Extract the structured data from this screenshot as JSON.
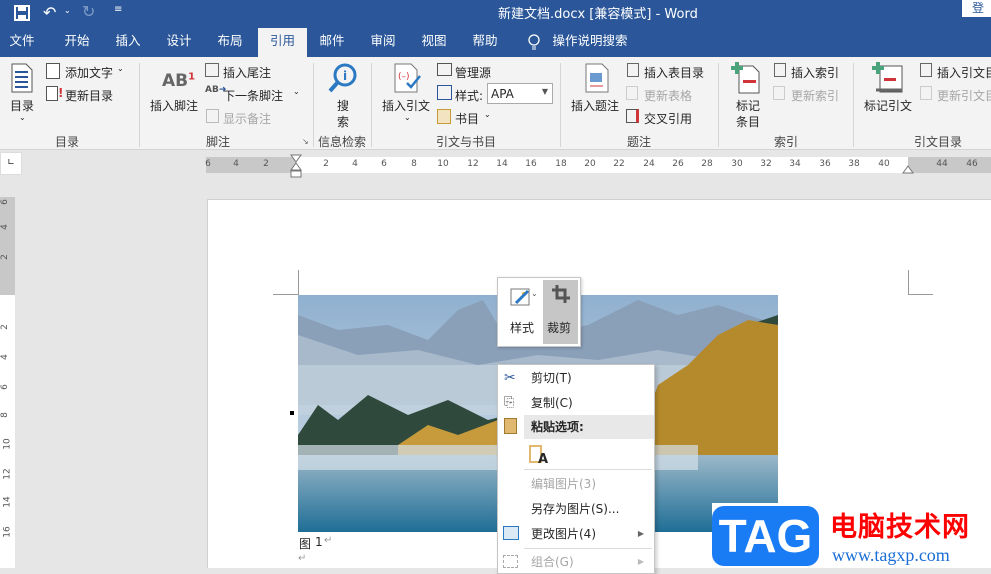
{
  "titlebar": {
    "title": "新建文档.docx [兼容模式]  -  Word",
    "login": "登录"
  },
  "tabs": [
    "文件",
    "开始",
    "插入",
    "设计",
    "布局",
    "引用",
    "邮件",
    "审阅",
    "视图",
    "帮助"
  ],
  "active_tab": "引用",
  "tell_me": "操作说明搜索",
  "ribbon": {
    "toc": {
      "toc": "目录",
      "add_text": "添加文字",
      "update_toc": "更新目录",
      "label": "目录"
    },
    "footnotes": {
      "insert_footnote": "插入脚注",
      "insert_endnote": "插入尾注",
      "next_footnote": "下一条脚注",
      "show_notes": "显示备注",
      "label": "脚注"
    },
    "research": {
      "search_1": "搜",
      "search_2": "索",
      "label": "信息检索"
    },
    "citations": {
      "insert_citation": "插入引文",
      "manage_sources": "管理源",
      "style_label": "样式:",
      "style_value": "APA",
      "bibliography": "书目",
      "label": "引文与书目"
    },
    "captions": {
      "insert_caption": "插入题注",
      "insert_tof": "插入表目录",
      "update_table": "更新表格",
      "cross_ref": "交叉引用",
      "label": "题注"
    },
    "index": {
      "mark_entry_1": "标记",
      "mark_entry_2": "条目",
      "insert_index": "插入索引",
      "update_index": "更新索引",
      "label": "索引"
    },
    "toa": {
      "mark_citation": "标记引文",
      "insert_toa": "插入引文目",
      "update_toa": "更新引文目",
      "label": "引文目录"
    }
  },
  "hruler": [
    "6",
    "4",
    "2",
    "2",
    "4",
    "6",
    "8",
    "10",
    "12",
    "14",
    "16",
    "18",
    "20",
    "22",
    "24",
    "26",
    "28",
    "30",
    "32",
    "34",
    "36",
    "38",
    "40",
    "44",
    "46"
  ],
  "vruler": [
    "6",
    "4",
    "2",
    "2",
    "4",
    "6",
    "8",
    "10",
    "12",
    "14",
    "16"
  ],
  "mini_toolbar": {
    "style": "样式",
    "crop": "裁剪"
  },
  "context_menu": {
    "cut": "剪切(T)",
    "copy": "复制(C)",
    "paste_options": "粘贴选项:",
    "edit_picture": "编辑图片(3)",
    "save_as_picture": "另存为图片(S)...",
    "change_picture": "更改图片(4)",
    "group": "组合(G)"
  },
  "caption": {
    "label": "图",
    "number": "1"
  },
  "watermark": {
    "logo": "TAG",
    "site_name": "电脑技术网",
    "url": "www.tagxp.com"
  },
  "colors": {
    "brand": "#2b579a",
    "ribbon": "#f3f3f3"
  }
}
